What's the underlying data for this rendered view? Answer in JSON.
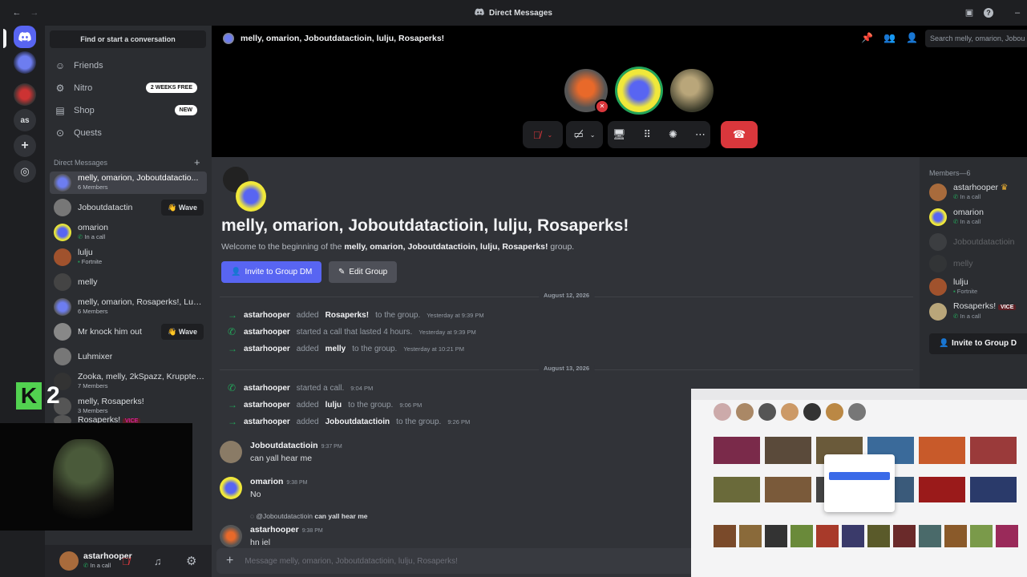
{
  "window": {
    "title": "Direct Messages"
  },
  "sidebar": {
    "find_label": "Find or start a conversation",
    "nav": [
      {
        "label": "Friends",
        "icon": "person-wave-icon"
      },
      {
        "label": "Nitro",
        "icon": "nitro-icon",
        "badge": "2 WEEKS FREE"
      },
      {
        "label": "Shop",
        "icon": "shop-icon",
        "badge": "NEW"
      },
      {
        "label": "Quests",
        "icon": "quests-icon"
      }
    ],
    "dm_header": "Direct Messages",
    "dms": [
      {
        "name": "melly, omarion, Joboutdatactio...",
        "sub": "6 Members"
      },
      {
        "name": "Joboutdatactin",
        "sub": "",
        "wave": "Wave"
      },
      {
        "name": "omarion",
        "sub": "In a call"
      },
      {
        "name": "lulju",
        "sub": "Fortnite"
      },
      {
        "name": "melly",
        "sub": ""
      },
      {
        "name": "melly, omarion, Rosaperks!, Luh...",
        "sub": "6 Members"
      },
      {
        "name": "Mr knock him out",
        "sub": "",
        "wave": "Wave"
      },
      {
        "name": "Luhmixer",
        "sub": ""
      },
      {
        "name": "Zooka, melly, 2kSpazz, Krupptet...",
        "sub": "7 Members"
      },
      {
        "name": "melly, Rosaperks!",
        "sub": "3 Members"
      },
      {
        "name": "Rosaperks!",
        "sub": "",
        "tag": "VICE"
      }
    ],
    "user": {
      "name": "astarhooper",
      "status": "In a call"
    }
  },
  "rail": {
    "short_label": "as"
  },
  "overlay": {
    "logo_text": "2"
  },
  "header": {
    "channel": "melly, omarion, Joboutdatactioin, lulju, Rosaperks!",
    "search_placeholder": "Search melly, omarion, Jobou"
  },
  "call": {
    "controls": [
      "mic-muted",
      "camera-off",
      "share-screen",
      "activities",
      "soundboard",
      "more",
      "leave-call"
    ]
  },
  "chat": {
    "title": "melly, omarion, Joboutdatactioin, lulju, Rosaperks!",
    "welcome_prefix": "Welcome to the beginning of the ",
    "welcome_name": "melly, omarion, Joboutdatactioin, lulju, Rosaperks!",
    "welcome_suffix": " group.",
    "invite_label": "Invite to Group DM",
    "edit_label": "Edit Group",
    "date1": "August 12, 2026",
    "date2": "August 13, 2026",
    "events": [
      {
        "icon": "arrow",
        "actor": "astarhooper",
        "verb": "added",
        "target": "Rosaperks!",
        "rest": "to the group.",
        "time": "Yesterday at 9:39 PM"
      },
      {
        "icon": "phone",
        "actor": "astarhooper",
        "verb": "started a call that lasted 4 hours.",
        "target": "",
        "rest": "",
        "time": "Yesterday at 9:39 PM"
      },
      {
        "icon": "arrow",
        "actor": "astarhooper",
        "verb": "added",
        "target": "melly",
        "rest": "to the group.",
        "time": "Yesterday at 10:21 PM"
      },
      {
        "icon": "phone",
        "actor": "astarhooper",
        "verb": "started a call.",
        "target": "",
        "rest": "",
        "time": "9:04 PM"
      },
      {
        "icon": "arrow",
        "actor": "astarhooper",
        "verb": "added",
        "target": "lulju",
        "rest": "to the group.",
        "time": "9:06 PM"
      },
      {
        "icon": "arrow",
        "actor": "astarhooper",
        "verb": "added",
        "target": "Joboutdatactioin",
        "rest": "to the group.",
        "time": "9:26 PM"
      }
    ],
    "messages": [
      {
        "author": "Joboutdatactioin",
        "time": "9:37 PM",
        "text": "can yall hear me"
      },
      {
        "author": "omarion",
        "time": "9:38 PM",
        "text": "No"
      },
      {
        "author": "astarhooper",
        "time": "9:38 PM",
        "text": "hn iel",
        "reply_author": "@Joboutdatactioin",
        "reply_text": "can yall hear me"
      }
    ],
    "composer_placeholder": "Message melly, omarion, Joboutdatactioin, lulju, Rosaperks!"
  },
  "members": {
    "header": "Members—6",
    "list": [
      {
        "name": "astarhooper",
        "status": "In a call",
        "crown": true
      },
      {
        "name": "omarion",
        "status": "In a call"
      },
      {
        "name": "Joboutdatactioin",
        "status": "",
        "dim": true
      },
      {
        "name": "melly",
        "status": "",
        "dim": true
      },
      {
        "name": "lulju",
        "status": "Fortnite"
      },
      {
        "name": "Rosaperks!",
        "status": "In a call",
        "tag": "VICE"
      }
    ],
    "invite_label": "Invite to Group D"
  },
  "colors": {
    "accent": "#5865f2",
    "danger": "#da373c",
    "online": "#23a55a",
    "bg_chat": "#313338",
    "bg_sidebar": "#2b2d31"
  }
}
